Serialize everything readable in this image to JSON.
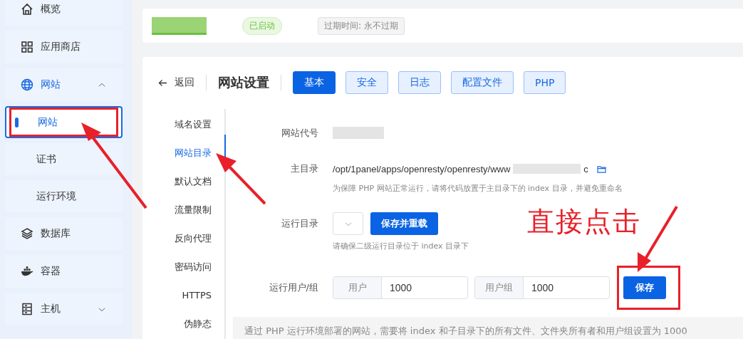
{
  "sidebar": {
    "items": [
      {
        "kind": "home",
        "label": "概览"
      },
      {
        "kind": "apps",
        "label": "应用商店"
      },
      {
        "kind": "globe",
        "label": "网站",
        "expanded": true,
        "selected": true,
        "children": [
          {
            "label": "网站",
            "selected": true,
            "highlighted": true
          },
          {
            "label": "证书",
            "selected": false,
            "highlighted": false
          },
          {
            "label": "运行环境",
            "selected": false,
            "highlighted": false
          }
        ]
      },
      {
        "kind": "database",
        "label": "数据库"
      },
      {
        "kind": "container",
        "label": "容器"
      },
      {
        "kind": "host",
        "label": "主机",
        "expanded": false
      }
    ]
  },
  "site_header": {
    "status": "已启动",
    "expiry": "过期时间: 永不过期"
  },
  "settings": {
    "back": "返回",
    "title": "网站设置",
    "tabs": [
      {
        "label": "基本",
        "selected": true
      },
      {
        "label": "安全",
        "selected": false
      },
      {
        "label": "日志",
        "selected": false
      },
      {
        "label": "配置文件",
        "selected": false
      },
      {
        "label": "PHP",
        "selected": false
      }
    ],
    "menu": [
      {
        "label": "域名设置",
        "selected": false
      },
      {
        "label": "网站目录",
        "selected": true
      },
      {
        "label": "默认文档",
        "selected": false
      },
      {
        "label": "流量限制",
        "selected": false
      },
      {
        "label": "反向代理",
        "selected": false
      },
      {
        "label": "密码访问",
        "selected": false
      },
      {
        "label": "HTTPS",
        "selected": false
      },
      {
        "label": "伪静态",
        "selected": false
      }
    ],
    "form": {
      "site_code_label": "网站代号",
      "root_label": "主目录",
      "root_path": "/opt/1panel/apps/openresty/openresty/www",
      "root_path_end": "c",
      "root_hint": "为保障 PHP 网站正常运行，请将代码放置于主目录下的 index 目录，并避免重命名",
      "run_dir_label": "运行目录",
      "save_reload": "保存并重载",
      "run_dir_hint": "请确保二级运行目录位于 index 目录下",
      "user_label": "运行用户/组",
      "user_prefix": "用户",
      "user_value": "1000",
      "group_prefix": "用户组",
      "group_value": "1000",
      "save": "保存",
      "save_highlighted": true,
      "notice": "通过 PHP 运行环境部署的网站，需要将 index 和子目录下的所有文件、文件夹所有者和用户组设置为 1000"
    }
  },
  "annotation": {
    "text": "直接点击"
  }
}
